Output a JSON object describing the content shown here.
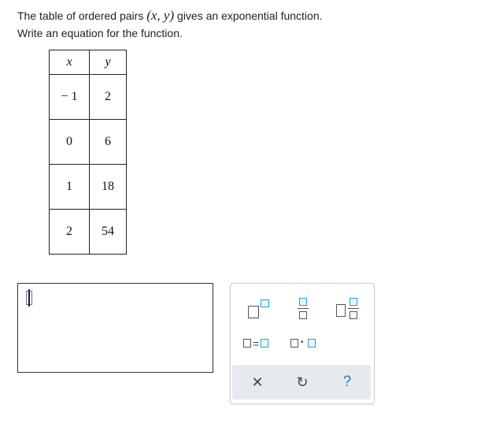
{
  "question": {
    "line1_prefix": "The table of ordered pairs ",
    "line1_math": "(x, y)",
    "line1_suffix": " gives an exponential function.",
    "line2": "Write an equation for the function."
  },
  "table": {
    "headers": [
      "x",
      "y"
    ],
    "rows": [
      [
        "− 1",
        "2"
      ],
      [
        "0",
        "6"
      ],
      [
        "1",
        "18"
      ],
      [
        "2",
        "54"
      ]
    ]
  },
  "answer": {
    "value": ""
  },
  "palette": {
    "eq_glyph": "=",
    "dot_glyph": "•",
    "clear_icon": "✕",
    "undo_icon": "↻",
    "help_icon": "?"
  },
  "colors": {
    "template_blue": "#1fa3d8",
    "help_blue": "#1f7bd1",
    "toolbar_bg": "#e6eaee"
  }
}
